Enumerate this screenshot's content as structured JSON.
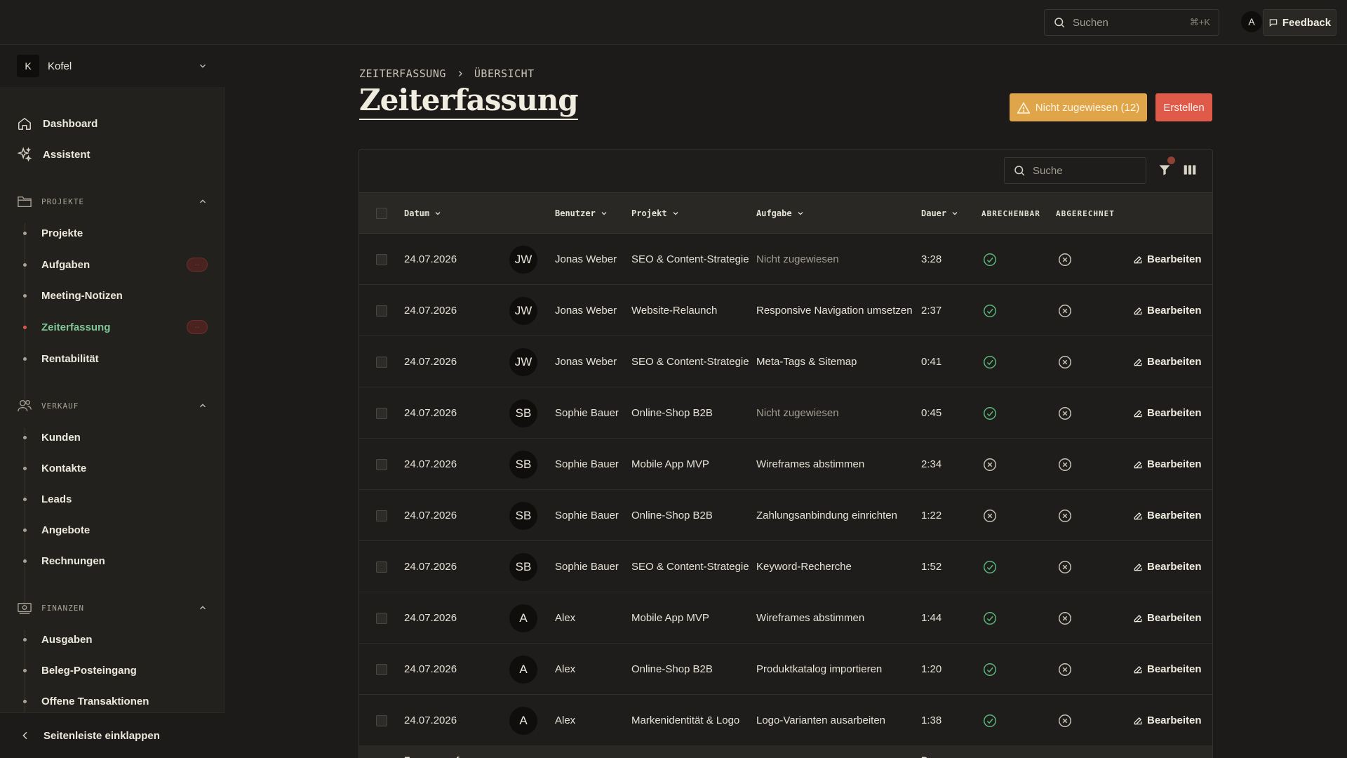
{
  "topbar": {
    "search_placeholder": "Suchen",
    "search_shortcut": "⌘+K",
    "avatar_initial": "A",
    "feedback_label": "Feedback"
  },
  "sidebar": {
    "workspace": {
      "initial": "K",
      "name": "Kofel"
    },
    "top_items": [
      {
        "label": "Dashboard",
        "icon": "home-icon"
      },
      {
        "label": "Assistent",
        "icon": "sparkles-icon"
      }
    ],
    "sections": [
      {
        "title": "PROJEKTE",
        "icon": "folder-icon",
        "items": [
          {
            "label": "Projekte"
          },
          {
            "label": "Aufgaben",
            "badge": "··"
          },
          {
            "label": "Meeting-Notizen"
          },
          {
            "label": "Zeiterfassung",
            "badge": "··",
            "active": true
          },
          {
            "label": "Rentabilität"
          }
        ]
      },
      {
        "title": "VERKAUF",
        "icon": "users-icon",
        "items": [
          {
            "label": "Kunden"
          },
          {
            "label": "Kontakte"
          },
          {
            "label": "Leads"
          },
          {
            "label": "Angebote"
          },
          {
            "label": "Rechnungen"
          }
        ]
      },
      {
        "title": "FINANZEN",
        "icon": "money-icon",
        "items": [
          {
            "label": "Ausgaben"
          },
          {
            "label": "Beleg-Posteingang"
          },
          {
            "label": "Offene Transaktionen"
          }
        ]
      }
    ],
    "collapse_label": "Seitenleiste einklappen"
  },
  "main": {
    "breadcrumb": [
      "ZEITERFASSUNG",
      "ÜBERSICHT"
    ],
    "title": "Zeiterfassung",
    "unassigned_button": "Nicht zugewiesen (12)",
    "create_button": "Erstellen",
    "table_search_placeholder": "Suche",
    "columns": {
      "date": "Datum",
      "user": "Benutzer",
      "project": "Projekt",
      "task": "Aufgabe",
      "duration": "Dauer",
      "billable": "ABRECHENBAR",
      "billed": "ABGERECHNET"
    },
    "edit_label": "Bearbeiten",
    "rows": [
      {
        "date": "24.07.2026",
        "initials": "JW",
        "user": "Jonas Weber",
        "project": "SEO & Content-Strategie",
        "task": "Nicht zugewiesen",
        "unassigned": true,
        "duration": "3:28",
        "billable": true,
        "billed": false
      },
      {
        "date": "24.07.2026",
        "initials": "JW",
        "user": "Jonas Weber",
        "project": "Website-Relaunch",
        "task": "Responsive Navigation umsetzen",
        "unassigned": false,
        "duration": "2:37",
        "billable": true,
        "billed": false
      },
      {
        "date": "24.07.2026",
        "initials": "JW",
        "user": "Jonas Weber",
        "project": "SEO & Content-Strategie",
        "task": "Meta-Tags & Sitemap",
        "unassigned": false,
        "duration": "0:41",
        "billable": true,
        "billed": false
      },
      {
        "date": "24.07.2026",
        "initials": "SB",
        "user": "Sophie Bauer",
        "project": "Online-Shop B2B",
        "task": "Nicht zugewiesen",
        "unassigned": true,
        "duration": "0:45",
        "billable": true,
        "billed": false
      },
      {
        "date": "24.07.2026",
        "initials": "SB",
        "user": "Sophie Bauer",
        "project": "Mobile App MVP",
        "task": "Wireframes abstimmen",
        "unassigned": false,
        "duration": "2:34",
        "billable": false,
        "billed": false
      },
      {
        "date": "24.07.2026",
        "initials": "SB",
        "user": "Sophie Bauer",
        "project": "Online-Shop B2B",
        "task": "Zahlungsanbindung einrichten",
        "unassigned": false,
        "duration": "1:22",
        "billable": false,
        "billed": false
      },
      {
        "date": "24.07.2026",
        "initials": "SB",
        "user": "Sophie Bauer",
        "project": "SEO & Content-Strategie",
        "task": "Keyword-Recherche",
        "unassigned": false,
        "duration": "1:52",
        "billable": true,
        "billed": false
      },
      {
        "date": "24.07.2026",
        "initials": "A",
        "user": "Alex",
        "project": "Mobile App MVP",
        "task": "Wireframes abstimmen",
        "unassigned": false,
        "duration": "1:44",
        "billable": true,
        "billed": false
      },
      {
        "date": "24.07.2026",
        "initials": "A",
        "user": "Alex",
        "project": "Online-Shop B2B",
        "task": "Produktkatalog importieren",
        "unassigned": false,
        "duration": "1:20",
        "billable": true,
        "billed": false
      },
      {
        "date": "24.07.2026",
        "initials": "A",
        "user": "Alex",
        "project": "Markenidentität & Logo",
        "task": "Logo-Varianten ausarbeiten",
        "unassigned": false,
        "duration": "1:38",
        "billable": true,
        "billed": false
      }
    ],
    "summary": {
      "label": "Zusammenfassung",
      "duration_label": "Dauer"
    }
  },
  "colors": {
    "background": "#1c1b19",
    "sidebar": "#23211e",
    "accent_green": "#7fc796",
    "check_green": "#5bb87a",
    "warning": "#e0a548",
    "danger": "#e05a4a"
  }
}
